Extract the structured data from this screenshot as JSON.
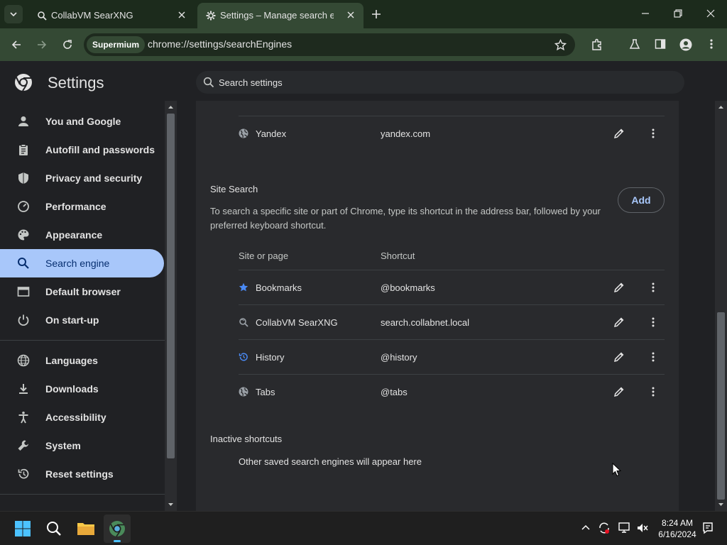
{
  "tabs": [
    {
      "title": "CollabVM SearXNG",
      "active": false
    },
    {
      "title": "Settings – Manage search engi",
      "active": true
    }
  ],
  "toolbar": {
    "chip": "Supermium",
    "url": "chrome://settings/searchEngines"
  },
  "header": {
    "title": "Settings",
    "search_placeholder": "Search settings"
  },
  "sidebar": {
    "items": [
      {
        "label": "You and Google",
        "icon": "person-icon"
      },
      {
        "label": "Autofill and passwords",
        "icon": "clipboard-icon"
      },
      {
        "label": "Privacy and security",
        "icon": "shield-icon"
      },
      {
        "label": "Performance",
        "icon": "speedometer-icon"
      },
      {
        "label": "Appearance",
        "icon": "palette-icon"
      },
      {
        "label": "Search engine",
        "icon": "search-icon",
        "active": true
      },
      {
        "label": "Default browser",
        "icon": "browser-icon"
      },
      {
        "label": "On start-up",
        "icon": "power-icon"
      },
      {
        "label": "Languages",
        "icon": "globe-icon"
      },
      {
        "label": "Downloads",
        "icon": "download-icon"
      },
      {
        "label": "Accessibility",
        "icon": "accessibility-icon"
      },
      {
        "label": "System",
        "icon": "wrench-icon"
      },
      {
        "label": "Reset settings",
        "icon": "reset-icon"
      }
    ]
  },
  "search_engines": {
    "visible_rows": [
      {
        "name": "Yandex",
        "shortcut": "yandex.com",
        "icon": "globe-icon"
      }
    ]
  },
  "site_search": {
    "title": "Site Search",
    "add_label": "Add",
    "description": "To search a specific site or part of Chrome, type its shortcut in the address bar, followed by your preferred keyboard shortcut.",
    "col_site": "Site or page",
    "col_shortcut": "Shortcut",
    "rows": [
      {
        "name": "Bookmarks",
        "shortcut": "@bookmarks",
        "icon": "star-icon"
      },
      {
        "name": "CollabVM SearXNG",
        "shortcut": "search.collabnet.local",
        "icon": "searxng-icon"
      },
      {
        "name": "History",
        "shortcut": "@history",
        "icon": "history-icon"
      },
      {
        "name": "Tabs",
        "shortcut": "@tabs",
        "icon": "globe-icon"
      }
    ]
  },
  "inactive": {
    "title": "Inactive shortcuts",
    "empty_text": "Other saved search engines will appear here"
  },
  "taskbar": {
    "time": "8:24 AM",
    "date": "6/16/2024"
  },
  "colors": {
    "accent": "#a8c7fa",
    "toolbar": "#344934",
    "card": "#292a2d"
  }
}
